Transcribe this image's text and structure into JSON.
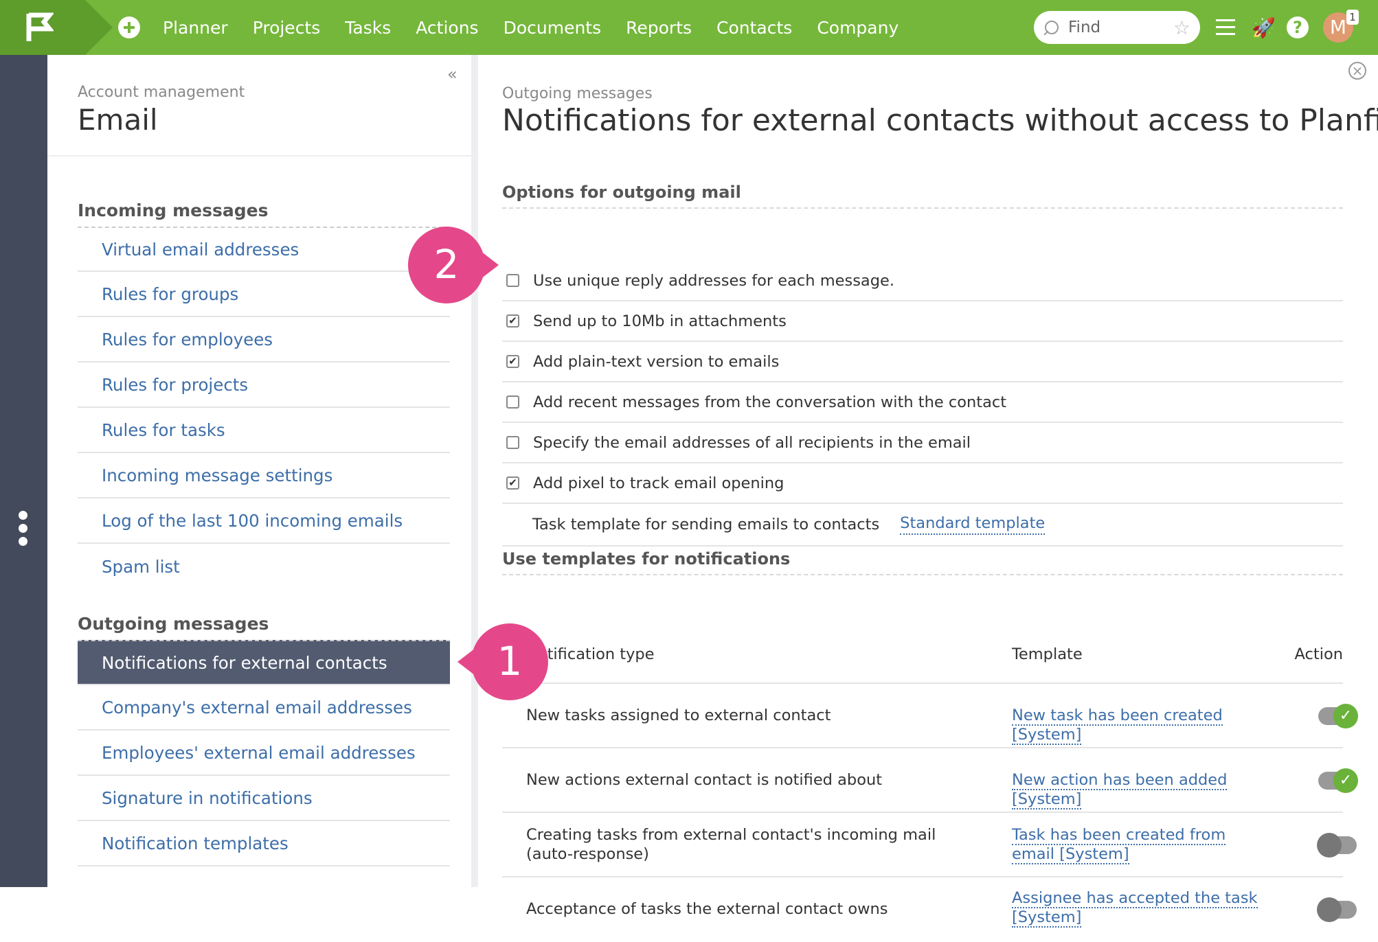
{
  "colors": {
    "brand_green": "#75b73b",
    "dark_strip": "#434a5b",
    "active_item": "#525b70",
    "link": "#3d6ea8",
    "callout": "#e5488a",
    "toggle_on": "#6ab23a"
  },
  "nav": {
    "items": [
      "Planner",
      "Projects",
      "Tasks",
      "Actions",
      "Documents",
      "Reports",
      "Contacts",
      "Company"
    ],
    "search_placeholder": "Find",
    "avatar_initial": "M",
    "notification_count": "1"
  },
  "left": {
    "subtitle": "Account management",
    "title": "Email",
    "incoming_title": "Incoming messages",
    "incoming_items": [
      "Virtual email addresses",
      "Rules for groups",
      "Rules for employees",
      "Rules for projects",
      "Rules for tasks",
      "Incoming message settings",
      "Log of the last 100 incoming emails",
      "Spam list"
    ],
    "outgoing_title": "Outgoing messages",
    "outgoing_items": [
      "Notifications for external contacts",
      "Company's external email addresses",
      "Employees' external email addresses",
      "Signature in notifications",
      "Notification templates"
    ],
    "active_item": "Notifications for external contacts"
  },
  "main": {
    "subtitle": "Outgoing messages",
    "title": "Notifications for external contacts without access to Planfix",
    "options_title": "Options for outgoing mail",
    "options": [
      {
        "label": "Use unique reply addresses for each message.",
        "checked": false
      },
      {
        "label": "Send up to 10Mb in attachments",
        "checked": true
      },
      {
        "label": "Add plain-text version to emails",
        "checked": true
      },
      {
        "label": "Add recent messages from the conversation with the contact",
        "checked": false
      },
      {
        "label": "Specify the email addresses of all recipients in the email",
        "checked": false
      },
      {
        "label": "Add pixel to track email opening",
        "checked": true
      }
    ],
    "task_template_label": "Task template for sending emails to contacts",
    "task_template_link": "Standard template",
    "templates_title": "Use templates for notifications",
    "table_headers": {
      "type": "Notification type",
      "template": "Template",
      "action": "Action"
    },
    "rows": [
      {
        "type": "New tasks assigned to external contact",
        "template": "New task has been created [System]",
        "enabled": true
      },
      {
        "type": "New actions external contact is notified about",
        "template": "New action has been added [System]",
        "enabled": true
      },
      {
        "type": "Creating tasks from external contact's incoming mail (auto-response)",
        "template": "Task has been created from email [System]",
        "enabled": false
      },
      {
        "type": "Acceptance of tasks the external contact owns",
        "template": "Assignee has accepted the task [System]",
        "enabled": false
      }
    ]
  },
  "callouts": [
    "1",
    "2"
  ]
}
